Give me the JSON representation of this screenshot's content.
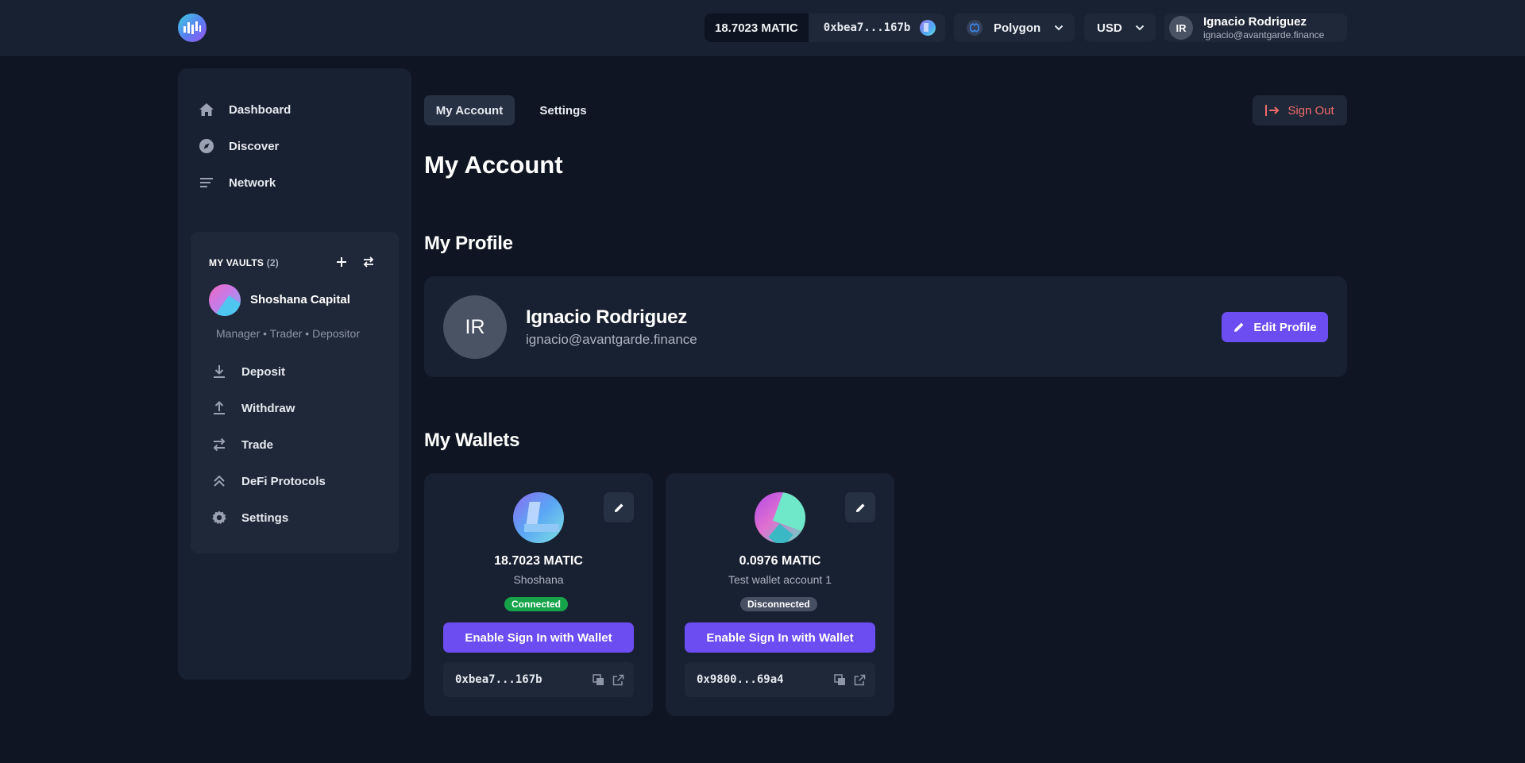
{
  "header": {
    "balance": "18.7023 MATIC",
    "address": "0xbea7...167b",
    "network": "Polygon",
    "currency": "USD",
    "user": {
      "initials": "IR",
      "name": "Ignacio Rodriguez",
      "email": "ignacio@avantgarde.finance"
    }
  },
  "sidebar": {
    "nav": [
      {
        "label": "Dashboard",
        "icon": "home-icon"
      },
      {
        "label": "Discover",
        "icon": "compass-icon"
      },
      {
        "label": "Network",
        "icon": "list-icon"
      }
    ],
    "vaults": {
      "heading": "MY VAULTS",
      "count": "(2)",
      "vault_name": "Shoshana Capital",
      "roles": "Manager • Trader • Depositor",
      "items": [
        {
          "label": "Deposit",
          "icon": "download-icon"
        },
        {
          "label": "Withdraw",
          "icon": "upload-icon"
        },
        {
          "label": "Trade",
          "icon": "swap-icon"
        },
        {
          "label": "DeFi Protocols",
          "icon": "chevrons-up-icon"
        },
        {
          "label": "Settings",
          "icon": "gear-icon"
        }
      ]
    }
  },
  "main": {
    "tabs": [
      "My Account",
      "Settings"
    ],
    "sign_out": "Sign Out",
    "title": "My Account",
    "profile_heading": "My Profile",
    "profile": {
      "initials": "IR",
      "name": "Ignacio Rodriguez",
      "email": "ignacio@avantgarde.finance",
      "edit_label": "Edit Profile"
    },
    "wallets_heading": "My Wallets",
    "wallets": [
      {
        "balance": "18.7023 MATIC",
        "name": "Shoshana",
        "status": "Connected",
        "button": "Enable Sign In with Wallet",
        "address": "0xbea7...167b"
      },
      {
        "balance": "0.0976 MATIC",
        "name": "Test wallet account 1",
        "status": "Disconnected",
        "button": "Enable Sign In with Wallet",
        "address": "0x9800...69a4"
      }
    ]
  },
  "colors": {
    "background": "#0f1522",
    "panel": "#182131",
    "accent": "#6c4df2",
    "connected": "#17a34a",
    "signout": "#ef6b6b"
  }
}
